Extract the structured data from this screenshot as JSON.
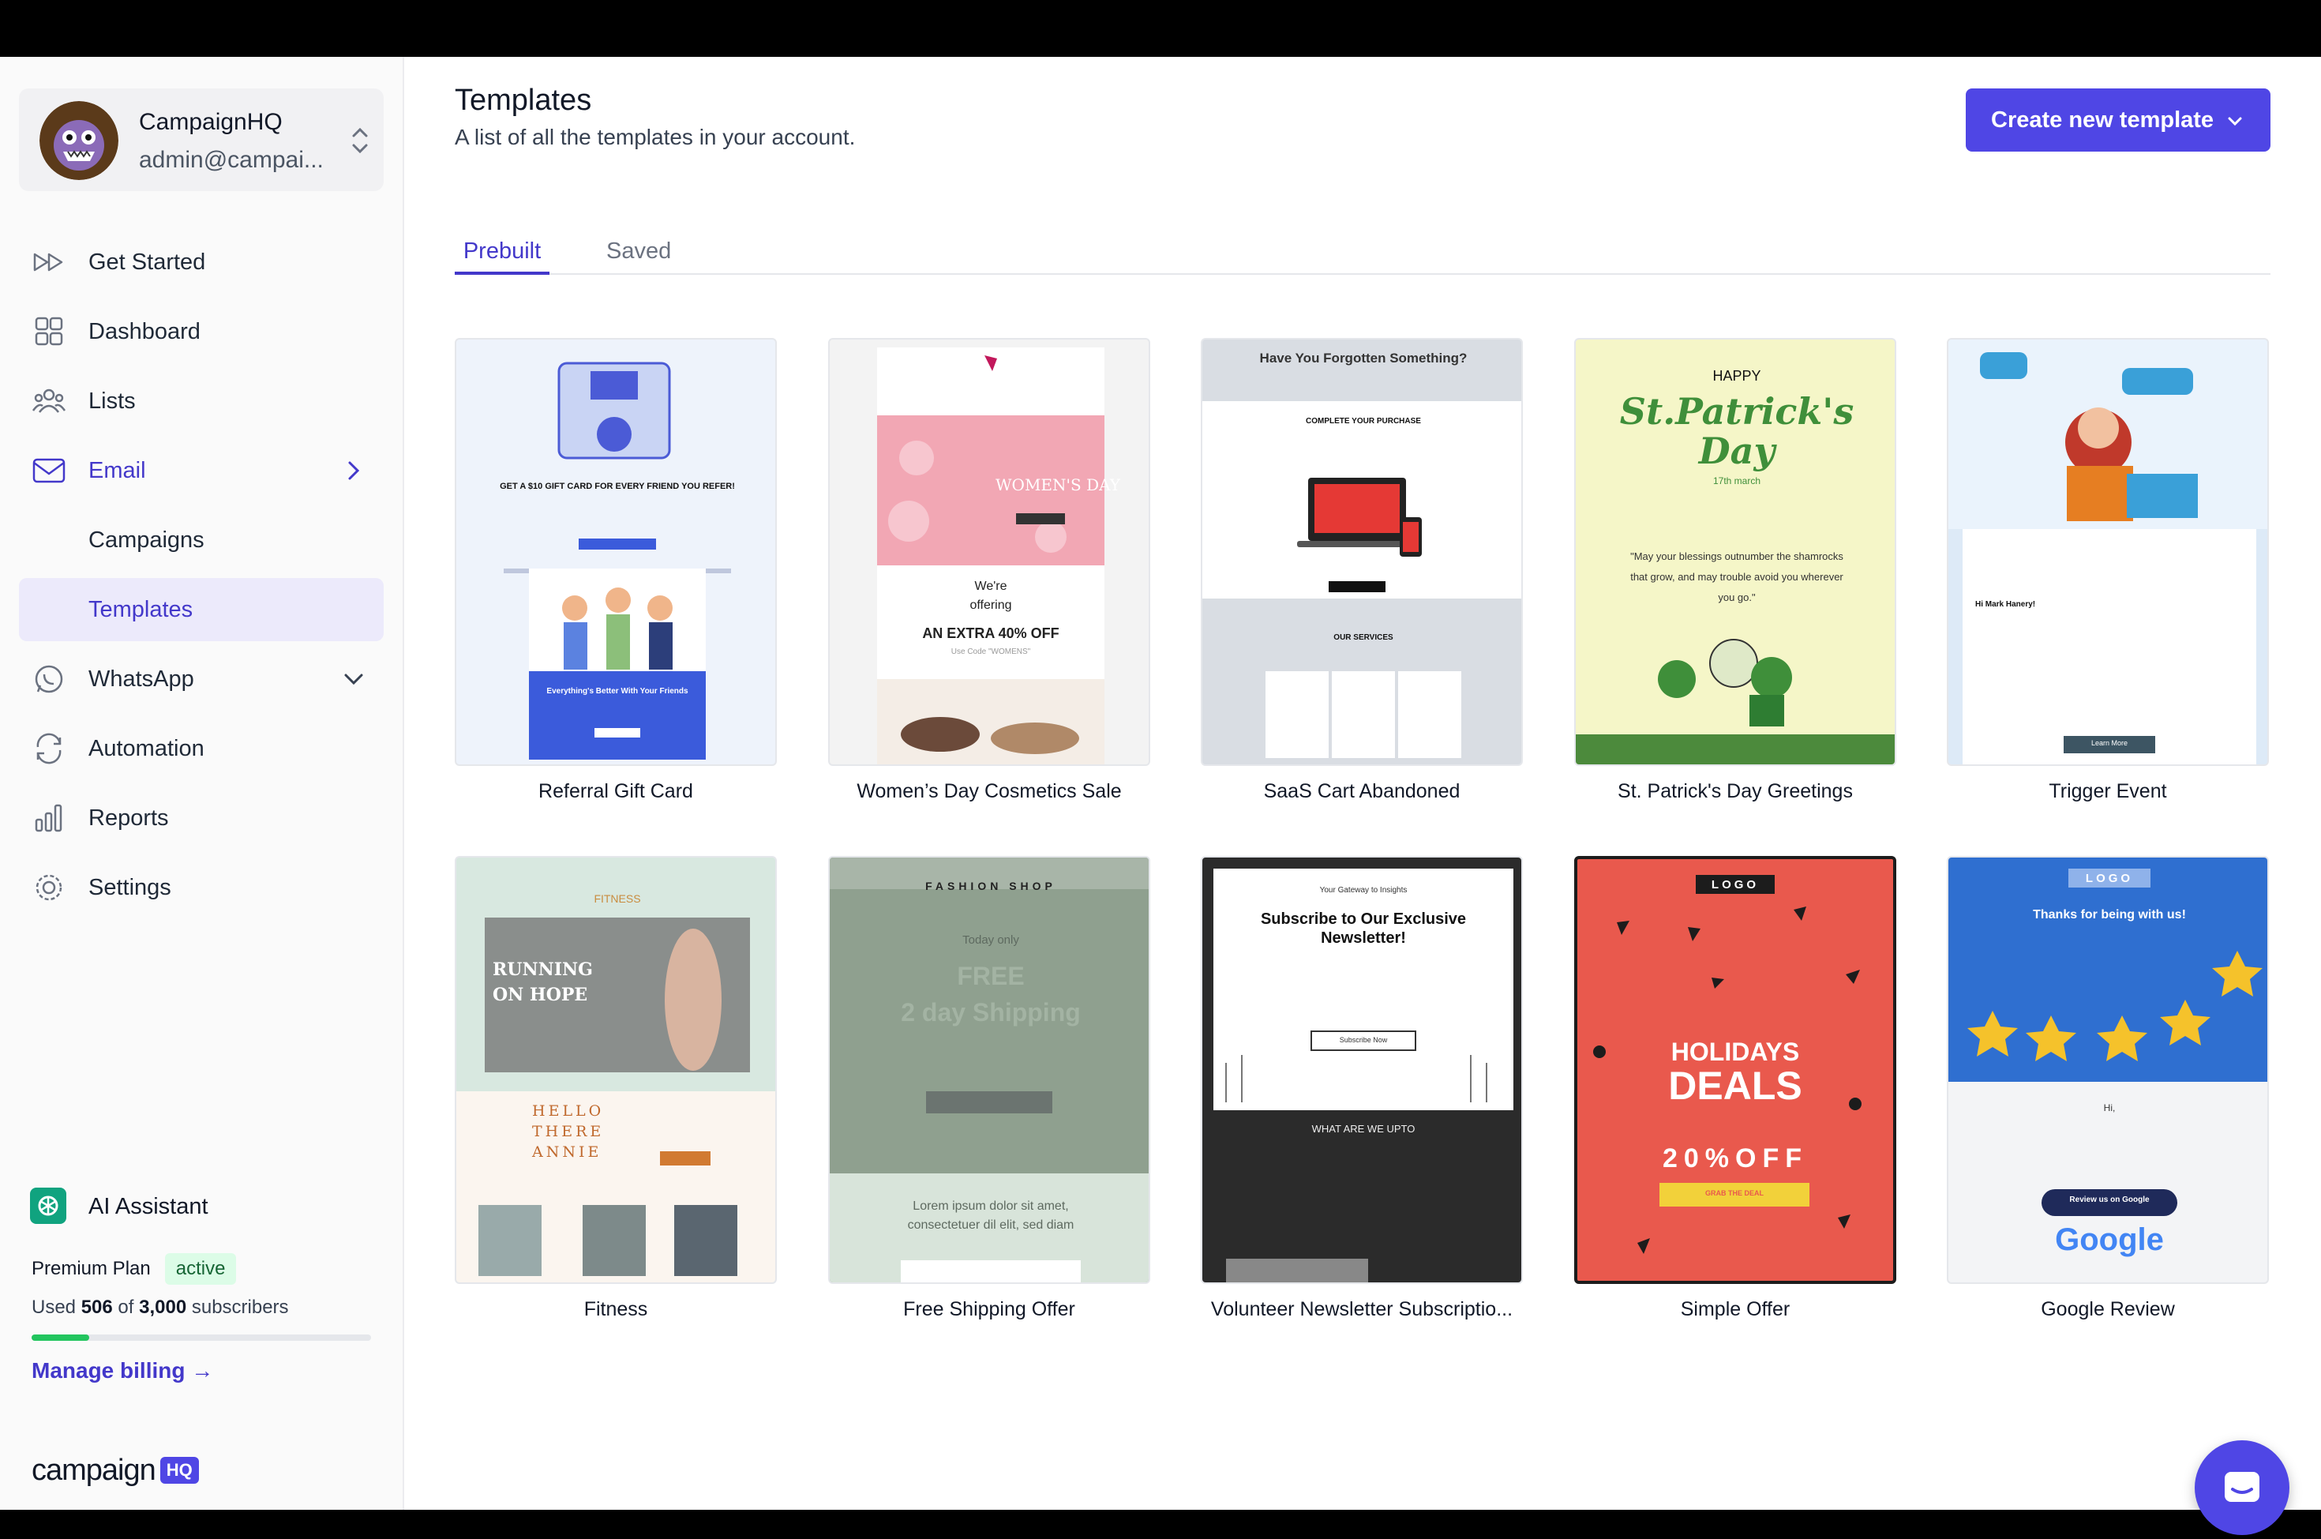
{
  "account": {
    "name": "CampaignHQ",
    "email": "admin@campai..."
  },
  "nav": {
    "get_started": "Get Started",
    "dashboard": "Dashboard",
    "lists": "Lists",
    "email": "Email",
    "campaigns": "Campaigns",
    "templates": "Templates",
    "whatsapp": "WhatsApp",
    "automation": "Automation",
    "reports": "Reports",
    "settings": "Settings"
  },
  "ai_assistant": "AI Assistant",
  "plan": {
    "name": "Premium Plan",
    "status": "active",
    "used_prefix": "Used",
    "used": "506",
    "of": "of",
    "total": "3,000",
    "unit": "subscribers",
    "usage_fraction": 0.169
  },
  "billing_link": "Manage billing →",
  "brand": {
    "word": "campaign",
    "badge": "HQ"
  },
  "page": {
    "title": "Templates",
    "subtitle": "A list of all the templates in your account.",
    "create_button": "Create new template"
  },
  "tabs": [
    "Prebuilt",
    "Saved"
  ],
  "templates": [
    {
      "name": "Referral Gift Card",
      "thumb": {
        "headline": "GET A $10 GIFT CARD FOR EVERY FRIEND YOU REFER!",
        "banner": "Everything's Better With Your Friends"
      }
    },
    {
      "name": "Women’s Day Cosmetics Sale",
      "thumb": {
        "headline": "WOMEN'S DAY",
        "line1": "We're",
        "line2": "offering",
        "offer": "AN EXTRA 40% OFF",
        "code": "Use Code \"WOMENS\""
      }
    },
    {
      "name": "SaaS Cart Abandoned",
      "thumb": {
        "headline": "Have You Forgotten Something?",
        "sub": "COMPLETE YOUR PURCHASE",
        "services": "OUR SERVICES"
      }
    },
    {
      "name": "St. Patrick's Day Greetings",
      "thumb": {
        "happy": "HAPPY",
        "title": "St.Patrick's Day",
        "date": "17th march",
        "quote": "\"May your blessings outnumber the shamrocks that grow, and may trouble avoid you wherever you go.\""
      }
    },
    {
      "name": "Trigger Event",
      "thumb": {
        "greeting": "Hi Mark Hanery!",
        "button": "Learn More"
      }
    },
    {
      "name": "Fitness",
      "thumb": {
        "brand": "FITNESS",
        "headline": "RUNNING ON HOPE",
        "hello": "HELLO THERE ANNIE"
      }
    },
    {
      "name": "Free Shipping Offer",
      "thumb": {
        "shop": "FASHION SHOP",
        "today": "Today only",
        "free": "FREE",
        "shipping": "2 day Shipping",
        "body": "Lorem ipsum dolor sit amet, consectetuer dil elit, sed diam"
      }
    },
    {
      "name": "Volunteer Newsletter Subscriptio...",
      "thumb": {
        "kicker": "Your Gateway to Insights",
        "headline": "Subscribe to Our Exclusive Newsletter!",
        "button": "Subscribe Now",
        "section": "WHAT ARE WE UPTO"
      }
    },
    {
      "name": "Simple Offer",
      "thumb": {
        "logo": "LOGO",
        "line1": "HOLIDAYS",
        "line2": "DEALS",
        "offer": "20%OFF",
        "button": "GRAB THE DEAL"
      }
    },
    {
      "name": "Google Review",
      "thumb": {
        "logo": "LOGO",
        "headline": "Thanks for being with us!",
        "hi": "Hi,",
        "button": "Review us on Google",
        "brand": "Google"
      }
    }
  ],
  "colors": {
    "accent": "#4f46e5",
    "accent_text": "#4338ca",
    "active_badge_bg": "#dcfce7",
    "progress": "#22c55e"
  }
}
